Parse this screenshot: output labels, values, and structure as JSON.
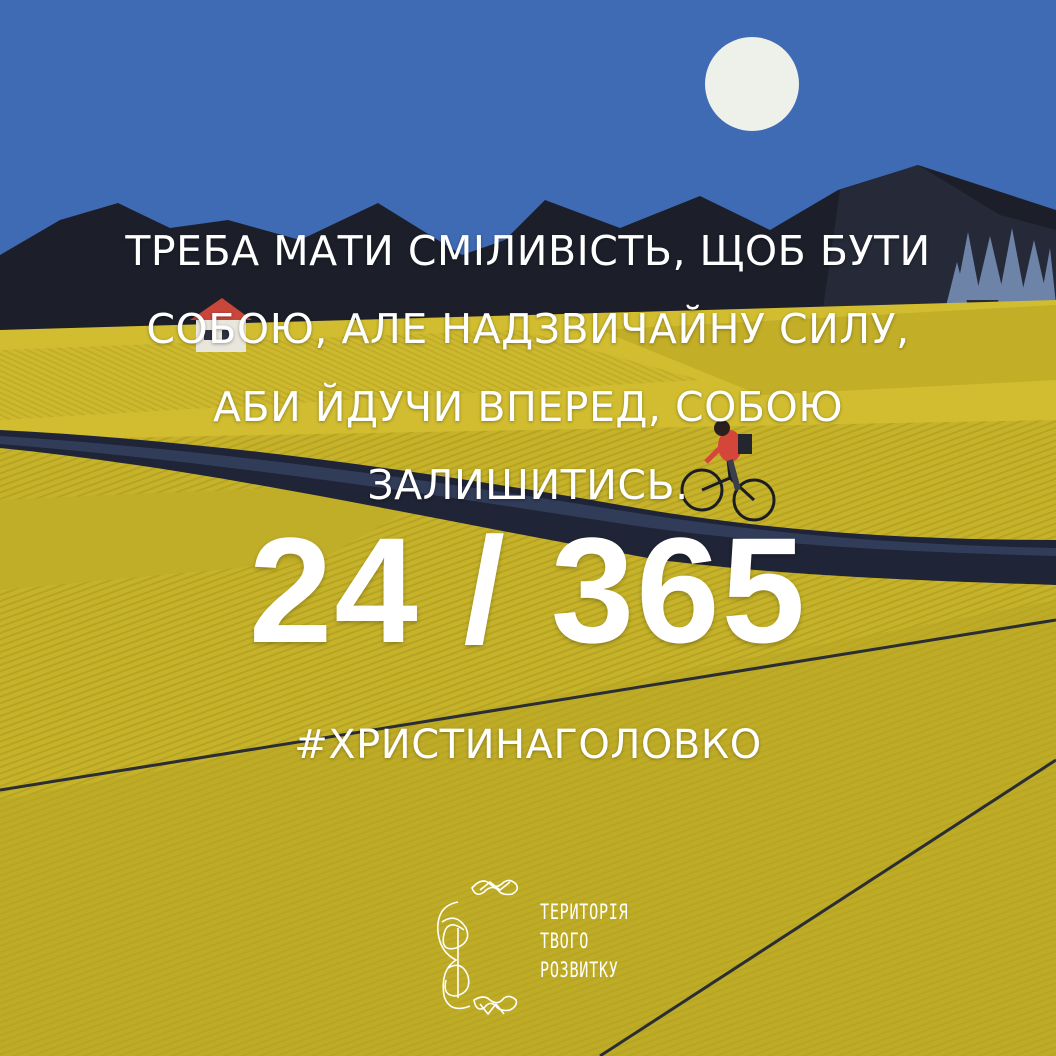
{
  "quote": {
    "lines": [
      "ТРЕБА МАТИ СМІЛИВІСТЬ, ЩОБ БУТИ",
      "СОБОЮ, АЛЕ НАДЗВИЧАЙНУ СИЛУ,",
      "АБИ ЙДУЧИ ВПЕРЕД, СОБОЮ",
      "ЗАЛИШИТИСЬ."
    ]
  },
  "counter": {
    "current": "24",
    "separator": "/",
    "total": "365",
    "text": "24 / 365"
  },
  "hashtag": "#ХРИСТИНАГОЛОВКО",
  "brand": {
    "lines": [
      "ТЕРИТОРІЯ",
      "ТВОГО",
      "РОЗВИТКУ"
    ]
  },
  "colors": {
    "sky": "#3f6bb5",
    "moon": "#eef0ea",
    "mountains": "#1c1f2a",
    "field": "#c9b52a",
    "road": "#1f2436",
    "text": "#ffffff"
  },
  "icons": [
    "moon-icon",
    "house-icon",
    "cyclist-icon",
    "territory-logo-icon"
  ]
}
